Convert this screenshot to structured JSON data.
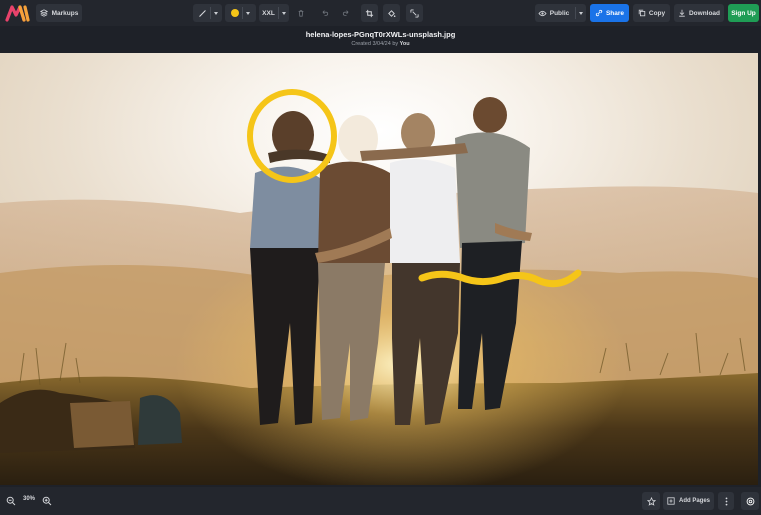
{
  "toolbar": {
    "markups_label": "Markups",
    "size_label": "XXL",
    "visibility_label": "Public",
    "share_label": "Share",
    "copy_label": "Copy",
    "download_label": "Download",
    "signup_label": "Sign Up",
    "pen_icon": "pen-icon",
    "color_swatch": "#f5c518",
    "accent_blue": "#1a73e8",
    "accent_green": "#1f9d55"
  },
  "header": {
    "filename": "helena-lopes-PGnqT0rXWLs-unsplash.jpg",
    "created_prefix": "Created 3/04/24 by",
    "created_by": "You"
  },
  "footer": {
    "zoom": "30%",
    "add_pages_label": "Add Pages"
  }
}
